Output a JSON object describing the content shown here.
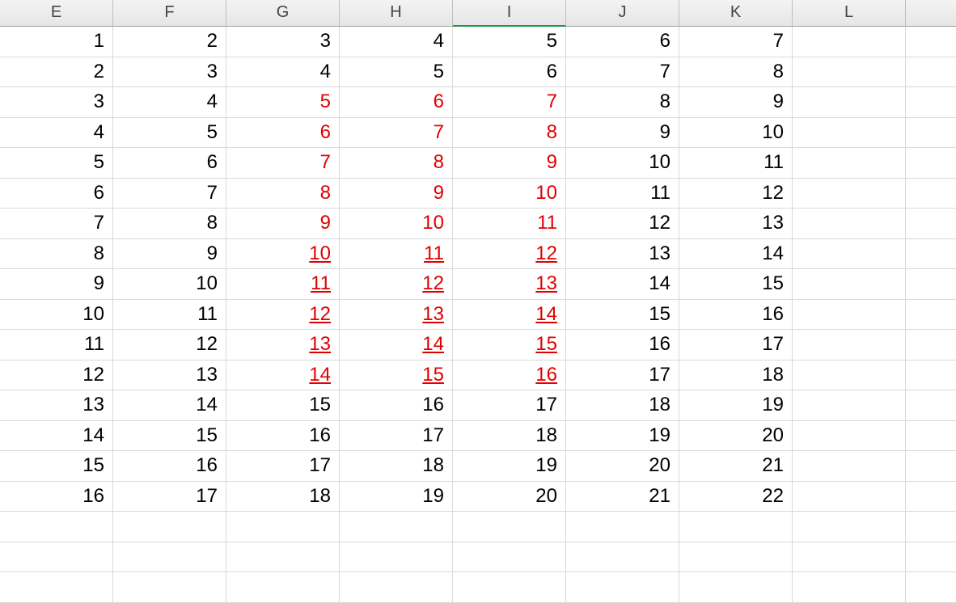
{
  "columns": [
    "E",
    "F",
    "G",
    "H",
    "I",
    "J",
    "K",
    "L",
    ""
  ],
  "selectedColumn": "I",
  "redRange": {
    "col_start": 2,
    "col_end": 4,
    "row_start": 2,
    "row_end": 11
  },
  "underlineRange": {
    "col_start": 2,
    "col_end": 4,
    "row_start": 7,
    "row_end": 11
  },
  "rows": [
    [
      "1",
      "2",
      "3",
      "4",
      "5",
      "6",
      "7",
      "",
      ""
    ],
    [
      "2",
      "3",
      "4",
      "5",
      "6",
      "7",
      "8",
      "",
      ""
    ],
    [
      "3",
      "4",
      "5",
      "6",
      "7",
      "8",
      "9",
      "",
      ""
    ],
    [
      "4",
      "5",
      "6",
      "7",
      "8",
      "9",
      "10",
      "",
      ""
    ],
    [
      "5",
      "6",
      "7",
      "8",
      "9",
      "10",
      "11",
      "",
      ""
    ],
    [
      "6",
      "7",
      "8",
      "9",
      "10",
      "11",
      "12",
      "",
      ""
    ],
    [
      "7",
      "8",
      "9",
      "10",
      "11",
      "12",
      "13",
      "",
      ""
    ],
    [
      "8",
      "9",
      "10",
      "11",
      "12",
      "13",
      "14",
      "",
      ""
    ],
    [
      "9",
      "10",
      "11",
      "12",
      "13",
      "14",
      "15",
      "",
      ""
    ],
    [
      "10",
      "11",
      "12",
      "13",
      "14",
      "15",
      "16",
      "",
      ""
    ],
    [
      "11",
      "12",
      "13",
      "14",
      "15",
      "16",
      "17",
      "",
      ""
    ],
    [
      "12",
      "13",
      "14",
      "15",
      "16",
      "17",
      "18",
      "",
      ""
    ],
    [
      "13",
      "14",
      "15",
      "16",
      "17",
      "18",
      "19",
      "",
      ""
    ],
    [
      "14",
      "15",
      "16",
      "17",
      "18",
      "19",
      "20",
      "",
      ""
    ],
    [
      "15",
      "16",
      "17",
      "18",
      "19",
      "20",
      "21",
      "",
      ""
    ],
    [
      "16",
      "17",
      "18",
      "19",
      "20",
      "21",
      "22",
      "",
      ""
    ],
    [
      "",
      "",
      "",
      "",
      "",
      "",
      "",
      "",
      ""
    ],
    [
      "",
      "",
      "",
      "",
      "",
      "",
      "",
      "",
      ""
    ],
    [
      "",
      "",
      "",
      "",
      "",
      "",
      "",
      "",
      ""
    ]
  ]
}
